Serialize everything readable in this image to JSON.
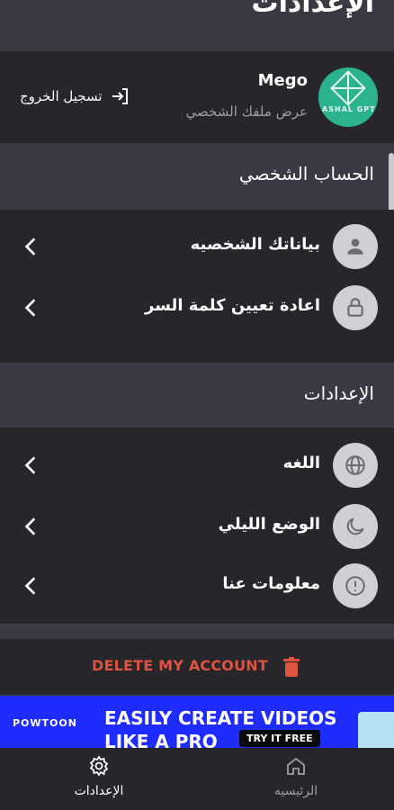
{
  "header": {
    "title": "الإعدادات"
  },
  "profile": {
    "name": "Mego",
    "subtitle": "عرض ملفك الشخصي",
    "avatar_text": "ASHAL GPT",
    "logout_label": "تسجيل الخروج"
  },
  "account_section": {
    "title": "الحساب الشخصي",
    "items": [
      {
        "label": "بياناتك الشخصيه",
        "icon": "person-icon"
      },
      {
        "label": "اعادة تعيين كلمة السر",
        "icon": "lock-icon"
      }
    ]
  },
  "settings_section": {
    "title": "الإعدادات",
    "items": [
      {
        "label": "اللغه",
        "icon": "globe-icon"
      },
      {
        "label": "الوضع الليلي",
        "icon": "moon-icon"
      },
      {
        "label": "معلومات عنا",
        "icon": "info-icon"
      }
    ]
  },
  "delete_account": {
    "label": "DELETE MY ACCOUNT",
    "color": "#e0533f"
  },
  "ad": {
    "brand": "POWTOON",
    "headline": "EASILY CREATE VIDEOS LIKE A PRO",
    "cta": "TRY IT FREE",
    "background": "#1f2cff"
  },
  "tabbar": {
    "tabs": [
      {
        "label": "الإعدادات",
        "icon": "gear-icon",
        "active": true
      },
      {
        "label": "الرئيسيه",
        "icon": "home-icon",
        "active": false
      }
    ]
  }
}
